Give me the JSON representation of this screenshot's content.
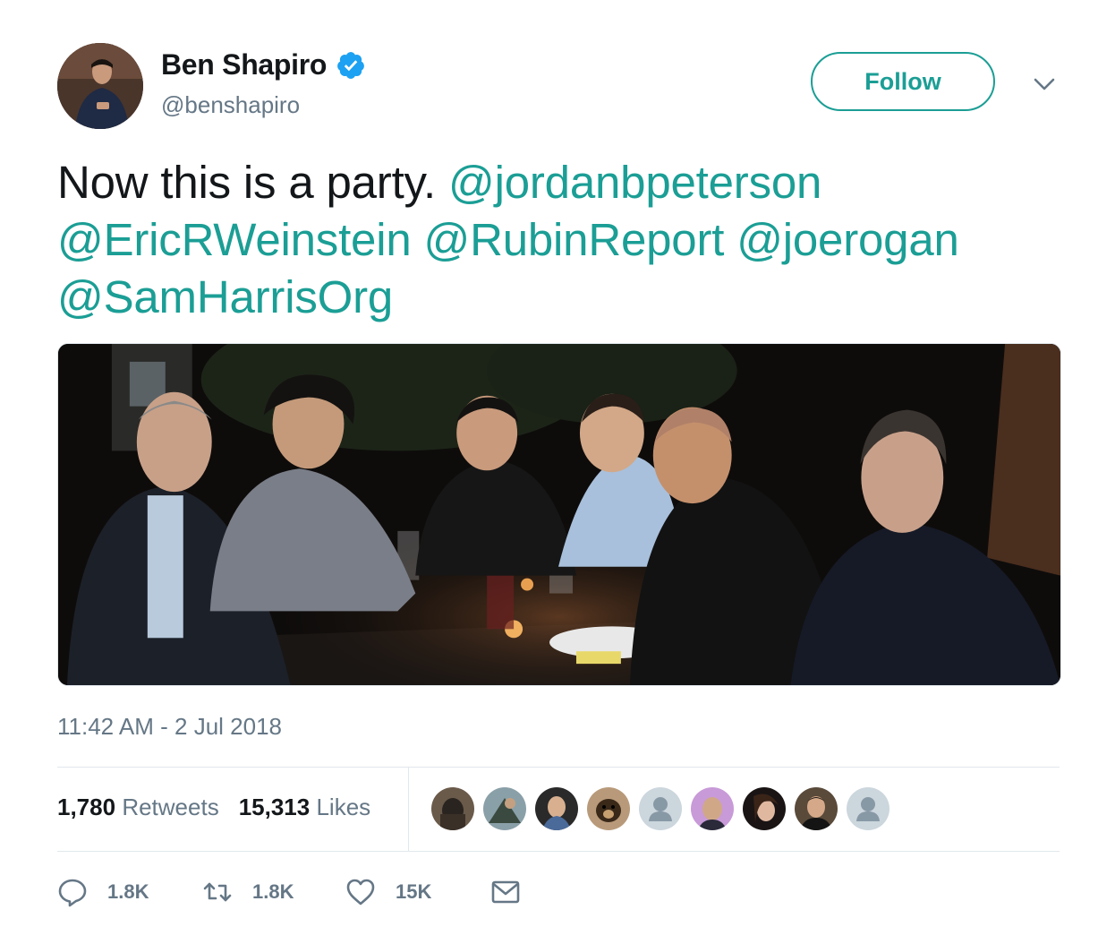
{
  "user": {
    "display_name": "Ben Shapiro",
    "handle": "@benshapiro",
    "verified": true,
    "avatar": "avatar-photo"
  },
  "follow_button": {
    "label": "Follow"
  },
  "tweet": {
    "text_plain": "Now this is a party.",
    "mentions": [
      "@jordanbpeterson",
      "@EricRWeinstein",
      "@RubinReport",
      "@joerogan",
      "@SamHarrisOrg"
    ],
    "image": "group-dinner-photo",
    "timestamp": "11:42 AM - 2 Jul 2018"
  },
  "stats": {
    "retweets_count": "1,780",
    "retweets_label": "Retweets",
    "likes_count": "15,313",
    "likes_label": "Likes"
  },
  "liker_avatars": [
    "liker-avatar",
    "liker-avatar",
    "liker-avatar",
    "liker-avatar",
    "default-avatar",
    "liker-avatar",
    "liker-avatar",
    "liker-avatar",
    "default-avatar"
  ],
  "actions": {
    "reply_count": "1.8K",
    "retweet_count": "1.8K",
    "like_count": "15K",
    "message_icon": "envelope-icon"
  },
  "colors": {
    "accent": "#1b9e95",
    "verified": "#1da1f2",
    "muted": "#657786",
    "text": "#14171a",
    "divider": "#e1e8ed"
  }
}
